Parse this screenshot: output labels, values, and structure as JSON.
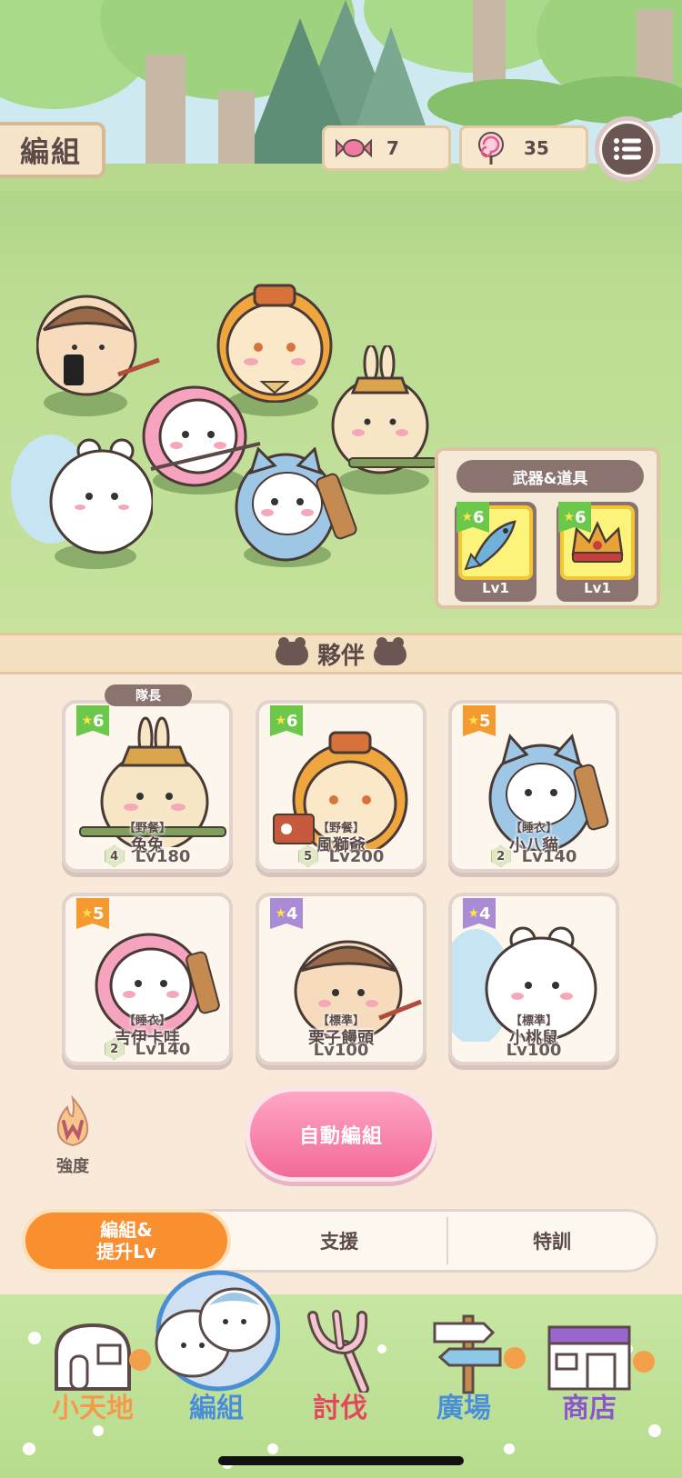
{
  "header": {
    "title": "編組",
    "candy": {
      "icon": "candy-icon",
      "value": "7"
    },
    "lollipop": {
      "icon": "lollipop-icon",
      "value": "35"
    },
    "menu_icon": "list-menu-icon"
  },
  "weapons_panel": {
    "title": "武器&道具",
    "items": [
      {
        "icon": "fish-weapon-icon",
        "stars": "6",
        "level": "Lv1"
      },
      {
        "icon": "crown-icon",
        "stars": "6",
        "level": "Lv1"
      }
    ]
  },
  "partners": {
    "title": "夥伴",
    "captain_label": "隊長",
    "cards": [
      {
        "stars": "6",
        "tag": "【野餐】",
        "name": "兔兔",
        "rank": "4",
        "level": "Lv180",
        "star_color": "#6cc84a"
      },
      {
        "stars": "6",
        "tag": "【野餐】",
        "name": "風獅爺",
        "rank": "5",
        "level": "Lv200",
        "star_color": "#6cc84a"
      },
      {
        "stars": "5",
        "tag": "【睡衣】",
        "name": "小八貓",
        "rank": "2",
        "level": "Lv140",
        "star_color": "#f59a2e"
      },
      {
        "stars": "5",
        "tag": "【睡衣】",
        "name": "吉伊卡哇",
        "rank": "2",
        "level": "Lv140",
        "star_color": "#f59a2e"
      },
      {
        "stars": "4",
        "tag": "【標準】",
        "name": "栗子饅頭",
        "rank": "",
        "level": "Lv100",
        "star_color": "#a98bd6"
      },
      {
        "stars": "4",
        "tag": "【標準】",
        "name": "小桃鼠",
        "rank": "",
        "level": "Lv100",
        "star_color": "#a98bd6"
      }
    ]
  },
  "strength_label": "強度",
  "auto_button": "自動編組",
  "tabs": [
    {
      "line1": "編組&",
      "line2": "提升Lv",
      "active": true
    },
    {
      "label": "支援"
    },
    {
      "label": "特訓"
    }
  ],
  "bottom_nav": [
    {
      "label": "小天地",
      "icon": "house-icon"
    },
    {
      "label": "編組",
      "icon": "team-icon",
      "active": true
    },
    {
      "label": "討伐",
      "icon": "pitchfork-icon"
    },
    {
      "label": "廣場",
      "icon": "signpost-icon"
    },
    {
      "label": "商店",
      "icon": "shop-icon"
    }
  ],
  "colors": {
    "accent_orange": "#f98f2e",
    "pink_button": "#f26a98",
    "nav_orange": "#f29a4a",
    "nav_blue": "#4a8fd3",
    "nav_red": "#e0495a",
    "nav_purple": "#8a57c8"
  }
}
